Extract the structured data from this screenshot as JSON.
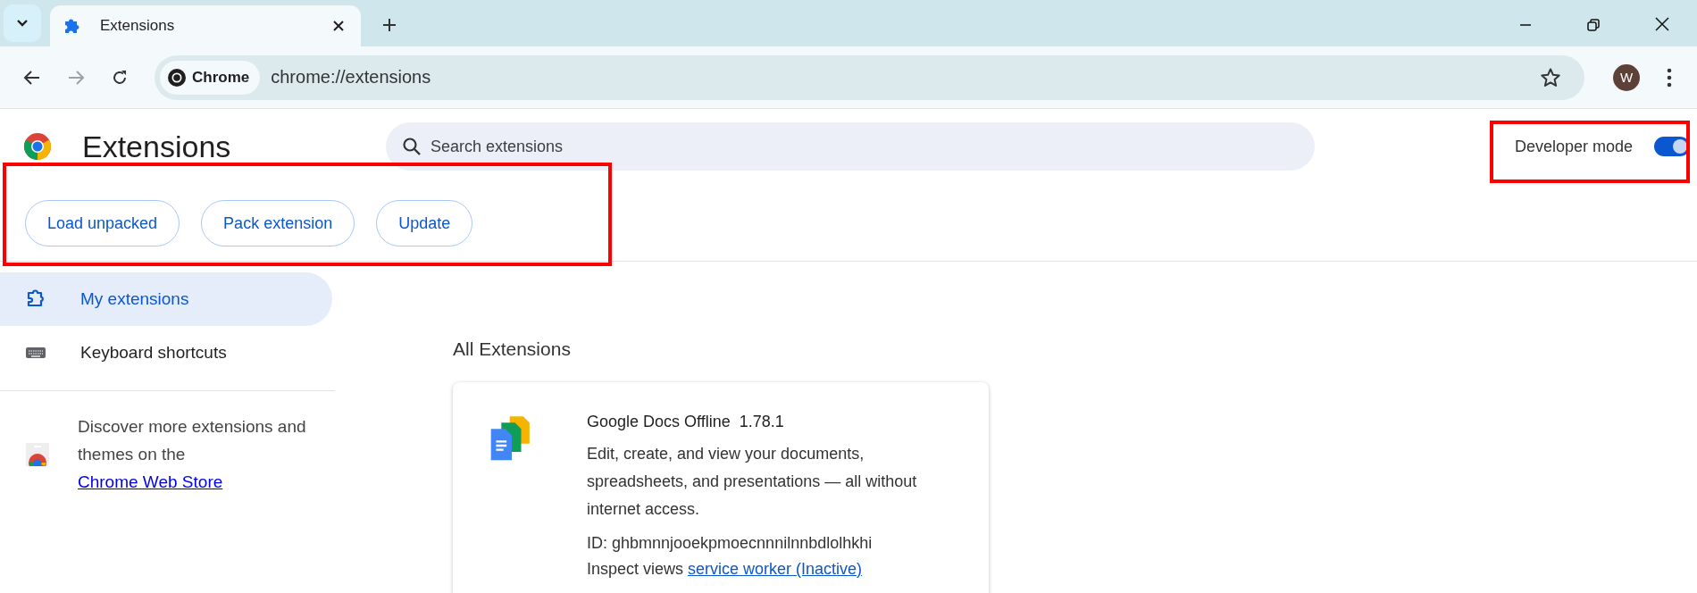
{
  "tabs": [
    {
      "title": "Extensions",
      "selected": true
    }
  ],
  "address_bar": {
    "site_chip": "Chrome",
    "url": "chrome://extensions"
  },
  "navigation": {
    "back_disabled": false,
    "forward_disabled": true
  },
  "profile": {
    "initial": "W"
  },
  "page": {
    "title": "Extensions",
    "search": {
      "placeholder": "Search extensions"
    }
  },
  "developer_mode": {
    "label": "Developer mode",
    "on": true
  },
  "action_buttons": [
    "Load unpacked",
    "Pack extension",
    "Update"
  ],
  "sidebar": {
    "items": [
      {
        "kind": "extensions",
        "label": "My extensions",
        "selected": true
      },
      {
        "kind": "shortcuts",
        "label": "Keyboard shortcuts",
        "selected": false
      }
    ],
    "promo": {
      "text": "Discover more extensions and themes on the ",
      "link": "Chrome Web Store"
    }
  },
  "section_title": "All Extensions",
  "extensions": [
    {
      "name": "Google Docs Offline",
      "version": "1.78.1",
      "description": "Edit, create, and view your documents, spreadsheets, and presentations — all without internet access.",
      "id": "ID: ghbmnnjooekpmoecnnnilnnbdlolhkhi",
      "inspect_label": "Inspect views",
      "inspect_link": "service worker (Inactive)"
    }
  ],
  "annotations": {
    "developer_mode_highlight": true,
    "action_buttons_highlight": true
  }
}
